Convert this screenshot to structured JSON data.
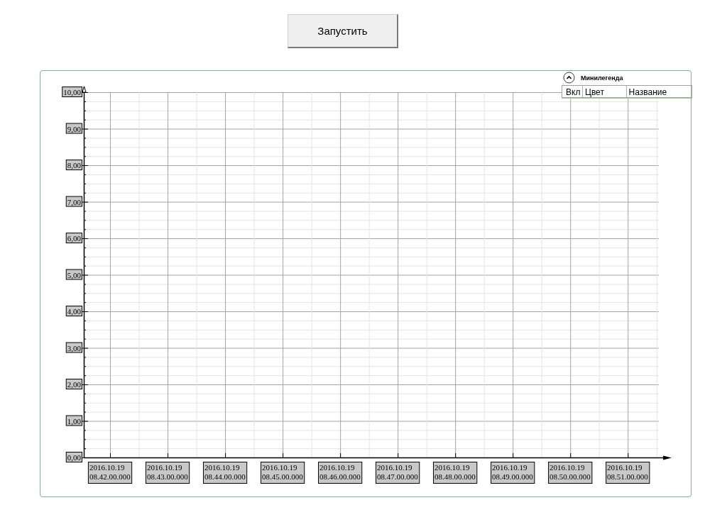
{
  "run_button": {
    "label": "Запустить"
  },
  "chart": {
    "legend": {
      "title": "Минилегенда",
      "expanded": true,
      "columns": [
        "Вкл",
        "Цвет",
        "Название"
      ]
    },
    "chart_data": {
      "type": "line",
      "grid": true,
      "ylim": [
        0,
        10
      ],
      "categories": [
        "2016.10.19\n08.42.00.000",
        "2016.10.19\n08.43.00.000",
        "2016.10.19\n08.44.00.000",
        "2016.10.19\n08.45.00.000",
        "2016.10.19\n08.46.00.000",
        "2016.10.19\n08.47.00.000",
        "2016.10.19\n08.48.00.000",
        "2016.10.19\n08.49.00.000",
        "2016.10.19\n08.50.00.000",
        "2016.10.19\n08.51.00.000"
      ],
      "yticks": [
        {
          "value": 0,
          "label": "0,00"
        },
        {
          "value": 1,
          "label": "1,00"
        },
        {
          "value": 2,
          "label": "2,00"
        },
        {
          "value": 3,
          "label": "3,00"
        },
        {
          "value": 4,
          "label": "4,00"
        },
        {
          "value": 5,
          "label": "5,00"
        },
        {
          "value": 6,
          "label": "6,00"
        },
        {
          "value": 7,
          "label": "7,00"
        },
        {
          "value": 8,
          "label": "8,00"
        },
        {
          "value": 9,
          "label": "9,00"
        },
        {
          "value": 10,
          "label": "10,00"
        }
      ]
    }
  }
}
